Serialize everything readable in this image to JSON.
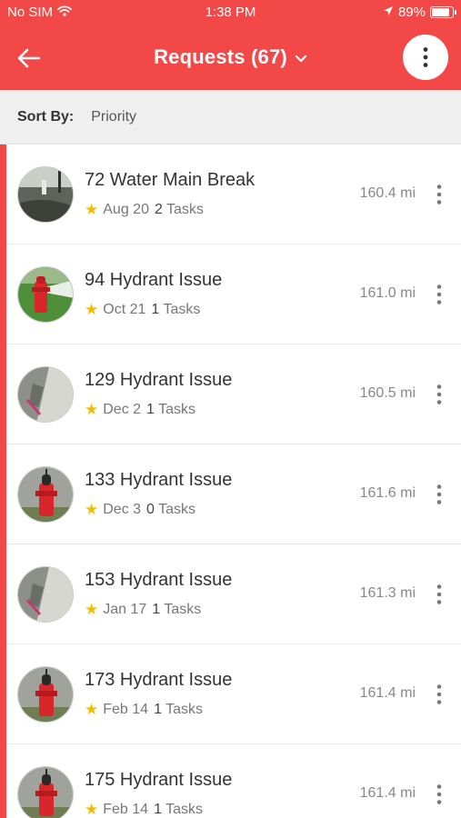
{
  "status_bar": {
    "carrier": "No SIM",
    "time": "1:38 PM",
    "battery": "89%",
    "battery_level": 0.89
  },
  "header": {
    "title": "Requests (67)",
    "back_icon": "arrow-left-icon",
    "menu_icon": "vertical-dots-icon",
    "color": "#f24848"
  },
  "sort": {
    "label": "Sort By:",
    "value": "Priority"
  },
  "requests": [
    {
      "title": "72 Water Main Break",
      "date": "Aug 20",
      "tasks_count": "2",
      "tasks_label": "Tasks",
      "distance": "160.4 mi",
      "thumb": "water-main"
    },
    {
      "title": "94 Hydrant Issue",
      "date": "Oct 21",
      "tasks_count": "1",
      "tasks_label": "Tasks",
      "distance": "161.0 mi",
      "thumb": "hydrant-spray"
    },
    {
      "title": "129 Hydrant Issue",
      "date": "Dec 2",
      "tasks_count": "1",
      "tasks_label": "Tasks",
      "distance": "160.5 mi",
      "thumb": "sidewalk"
    },
    {
      "title": "133 Hydrant Issue",
      "date": "Dec 3",
      "tasks_count": "0",
      "tasks_label": "Tasks",
      "distance": "161.6 mi",
      "thumb": "hydrant"
    },
    {
      "title": "153 Hydrant Issue",
      "date": "Jan 17",
      "tasks_count": "1",
      "tasks_label": "Tasks",
      "distance": "161.3 mi",
      "thumb": "sidewalk"
    },
    {
      "title": "173 Hydrant Issue",
      "date": "Feb 14",
      "tasks_count": "1",
      "tasks_label": "Tasks",
      "distance": "161.4 mi",
      "thumb": "hydrant"
    },
    {
      "title": "175 Hydrant Issue",
      "date": "Feb 14",
      "tasks_count": "1",
      "tasks_label": "Tasks",
      "distance": "161.4 mi",
      "thumb": "hydrant"
    }
  ],
  "colors": {
    "accent": "#f24848",
    "star": "#f2bd00"
  }
}
